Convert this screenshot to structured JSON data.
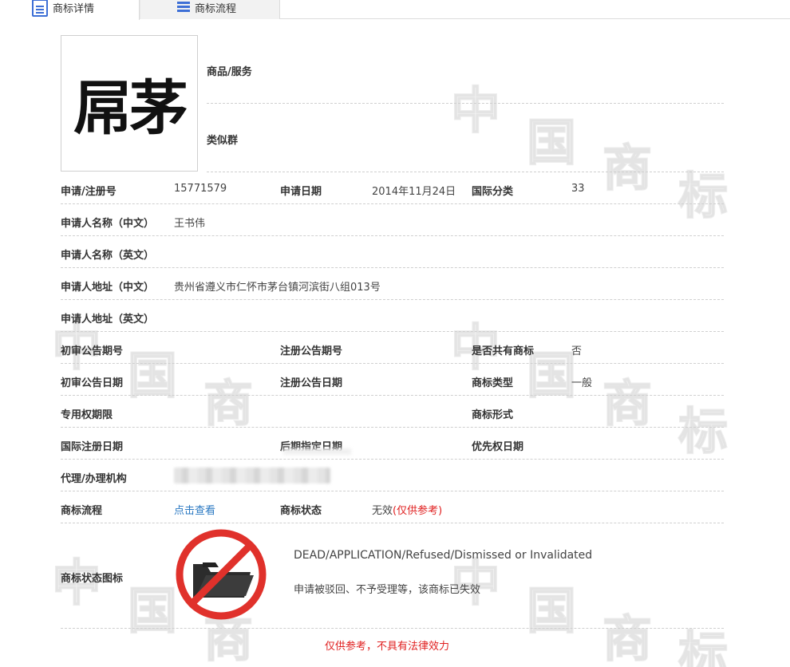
{
  "tabs": [
    {
      "label": "商标详情",
      "icon": "document-icon",
      "active": true
    },
    {
      "label": "商标流程",
      "icon": "list-icon",
      "active": false
    }
  ],
  "logo": {
    "text": "屌茅"
  },
  "watermark": [
    "中",
    "国",
    "商",
    "标"
  ],
  "top": {
    "goods_label": "商品/服务",
    "group_label": "类似群"
  },
  "rows": {
    "reg_no_label": "申请/注册号",
    "reg_no": "15771579",
    "app_date_label": "申请日期",
    "app_date": "2014年11月24日",
    "intl_class_label": "国际分类",
    "intl_class": "33",
    "applicant_cn_label": "申请人名称（中文）",
    "applicant_cn": "王书伟",
    "applicant_en_label": "申请人名称（英文）",
    "address_cn_label": "申请人地址（中文）",
    "address_cn": "贵州省遵义市仁怀市茅台镇河滨街八组013号",
    "address_en_label": "申请人地址（英文）",
    "prelim_no_label": "初审公告期号",
    "reg_pub_no_label": "注册公告期号",
    "shared_label": "是否共有商标",
    "shared": "否",
    "prelim_date_label": "初审公告日期",
    "reg_pub_date_label": "注册公告日期",
    "tm_type_label": "商标类型",
    "tm_type": "一般",
    "exclusive_label": "专用权期限",
    "tm_form_label": "商标形式",
    "intl_reg_date_label": "国际注册日期",
    "later_date_label": "后期指定日期",
    "priority_date_label": "优先权日期",
    "agent_label": "代理/办理机构",
    "flow_label": "商标流程",
    "flow_link": "点击查看",
    "status_label": "商标状态",
    "status_value": "无效",
    "status_note": "(仅供参考)"
  },
  "status_icon": {
    "label": "商标状态图标",
    "en": "DEAD/APPLICATION/Refused/Dismissed or Invalidated",
    "cn": "申请被驳回、不予受理等，该商标已失效"
  },
  "footer": "仅供参考，不具有法律效力",
  "colors": {
    "accent": "#2a78c2",
    "warning": "#e02020",
    "tab_icon": "#3d6fd6"
  }
}
